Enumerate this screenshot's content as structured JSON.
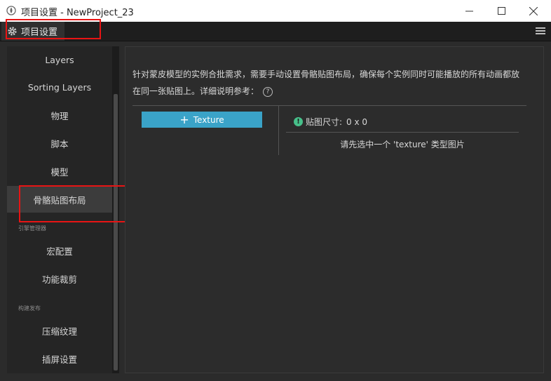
{
  "window": {
    "title": "项目设置 - NewProject_23",
    "controls": [
      "minimize-icon",
      "maximize-icon",
      "close-icon"
    ]
  },
  "panel": {
    "tab_label": "项目设置",
    "tab_icon": "gear-icon",
    "menu_icon": "hamburger-menu-icon"
  },
  "sidebar": {
    "items": [
      {
        "label": "Layers"
      },
      {
        "label": "Sorting Layers"
      },
      {
        "label": "物理"
      },
      {
        "label": "脚本"
      },
      {
        "label": "模型"
      },
      {
        "label": "骨骼贴图布局"
      },
      {
        "label": "宏配置"
      },
      {
        "label": "功能裁剪"
      },
      {
        "label": "压缩纹理"
      },
      {
        "label": "插屏设置"
      }
    ],
    "active_label": "骨骼贴图布局",
    "groups": [
      {
        "label": "引擎管理器"
      },
      {
        "label": "构建发布"
      }
    ]
  },
  "main": {
    "description_line1": "针对蒙皮模型的实例合批需求，需要手动设置骨骼贴图布局，确保每个实例同时可能播放的所有动画都放",
    "description_line2": "在同一张贴图上。详细说明参考：",
    "help_icon": "?",
    "add_button_label": "Texture",
    "size_label": "贴图尺寸:",
    "size_value": "0 x 0",
    "hint": "请先选中一个 'texture' 类型图片"
  },
  "colors": {
    "accent": "#3aa3c8",
    "info": "#47c08a",
    "highlight": "#e81414"
  }
}
